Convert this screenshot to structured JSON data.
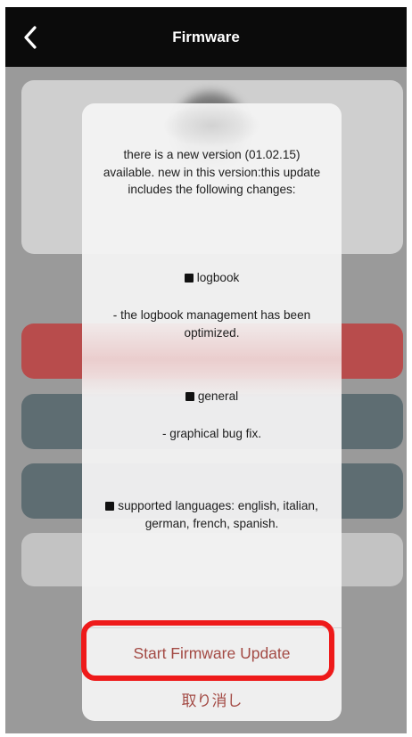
{
  "header": {
    "title": "Firmware"
  },
  "dialog": {
    "intro": "there is a new version (01.02.15) available. new in this version:this update includes the following changes:",
    "sections": [
      {
        "heading": "logbook",
        "detail": "- the logbook management has been optimized."
      },
      {
        "heading": "general",
        "detail": "- graphical bug fix."
      },
      {
        "heading": "supported languages: english, italian, german, french, spanish.",
        "detail": ""
      }
    ],
    "primary_action": "Start Firmware Update",
    "cancel_action": "取り消し"
  },
  "colors": {
    "header_bg": "#0b0b0b",
    "action_text": "#a34a44",
    "highlight_border": "#ee1a1a",
    "bg_red_button": "#b84c4c",
    "bg_slate_button": "#5e6d72"
  },
  "icons": {
    "back": "chevron-left-icon",
    "bullet": "black-square-bullet"
  }
}
